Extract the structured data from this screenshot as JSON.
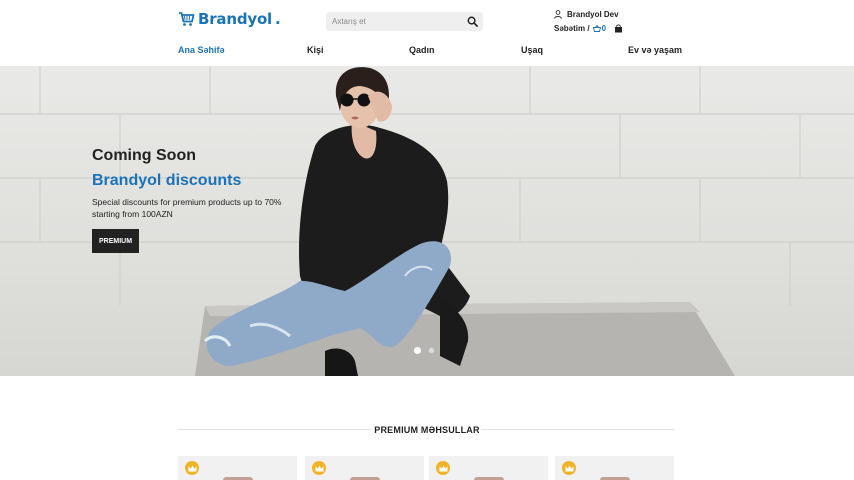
{
  "brand": {
    "name": "Brandyol",
    "accent": "#1a73b8"
  },
  "search": {
    "placeholder": "Axtarış et"
  },
  "user": {
    "name": "Brandyol Dev"
  },
  "cart": {
    "label": "Səbətim /",
    "count": "0"
  },
  "nav": [
    {
      "label": "Ana Səhifə",
      "active": true
    },
    {
      "label": "Kişi"
    },
    {
      "label": "Qadın"
    },
    {
      "label": "Uşaq"
    },
    {
      "label": "Ev və yaşam"
    }
  ],
  "hero": {
    "title": "Coming Soon",
    "subtitle": "Brandyol discounts",
    "description": "Special discounts for premium products up to 70% starting from 100AZN",
    "button": "PREMIUM",
    "slides_total": 2,
    "active_slide": 1
  },
  "section": {
    "title": "PREMIUM MƏHSULLAR"
  },
  "products": [
    {
      "badge_icon": "crown-icon"
    },
    {
      "badge_icon": "crown-icon"
    },
    {
      "badge_icon": "crown-icon"
    },
    {
      "badge_icon": "crown-icon"
    }
  ]
}
